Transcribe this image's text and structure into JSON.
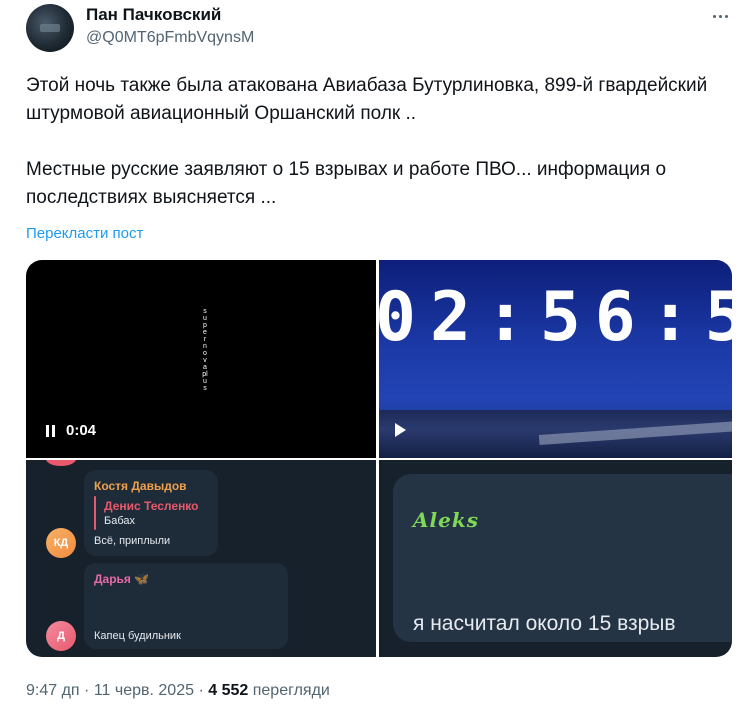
{
  "author": {
    "display_name": "Пан Пачковский",
    "handle": "@Q0MT6pFmbVqynsM"
  },
  "tweet": {
    "line1": "Этой ночь также была атакована Авиабаза Бутурлиновка, 899-й гвардейский штурмовой авиационный Оршанский полк ..",
    "line2": "Местные русские заявляют о 15 взрывах и работе ПВО... информация о последствиях выясняется ...",
    "translate_label": "Перекласти пост"
  },
  "media": {
    "video1": {
      "vertical_text": "supernova plus",
      "time": "0:04",
      "state": "playing"
    },
    "video2": {
      "clock_text": "02:56:5"
    },
    "chat": {
      "msg1": {
        "sender": "Костя Давыдов",
        "reply_sender": "Денис Тесленко",
        "reply_text": "Бабах",
        "text": "Всё, приплыли",
        "avatar_initials": "КД"
      },
      "msg2": {
        "sender": "Дарья",
        "badge": "🦋",
        "text": "Капец будильник",
        "avatar_initials": "Д"
      }
    },
    "aleks": {
      "name": "Aleks",
      "text": "я насчитал около 15 взрыв"
    }
  },
  "footer": {
    "time": "9:47 дп",
    "separator": "·",
    "date": "11 черв. 2025",
    "views_count": "4 552",
    "views_label": "перегляди"
  },
  "colors": {
    "link": "#1d9bf0",
    "secondary_text": "#536471",
    "chat_bg": "#17212b",
    "sender_orange": "#f0a04a",
    "sender_red": "#e8596c",
    "sender_pink": "#e86aa6",
    "aleks_green": "#7fd957"
  }
}
